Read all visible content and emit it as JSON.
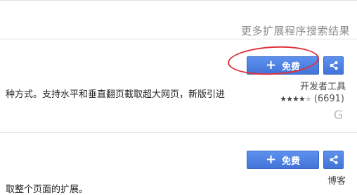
{
  "header": {
    "more_results_link": "更多扩展程序搜索结果"
  },
  "items": [
    {
      "description": "种方式。支持水平和垂直翻页截取超大网页，新版引进",
      "free_label": "免费",
      "category": "开发者工具",
      "stars": 4,
      "rating_count": "(6691)",
      "badge": "G"
    },
    {
      "description": "取整个页面的扩展。",
      "free_label": "免费",
      "category": "博客"
    }
  ],
  "icons": {
    "plus": "plus-icon",
    "share": "share-icon"
  },
  "colors": {
    "button_blue": "#4a7fe0",
    "annotation_red": "#e0303a"
  }
}
